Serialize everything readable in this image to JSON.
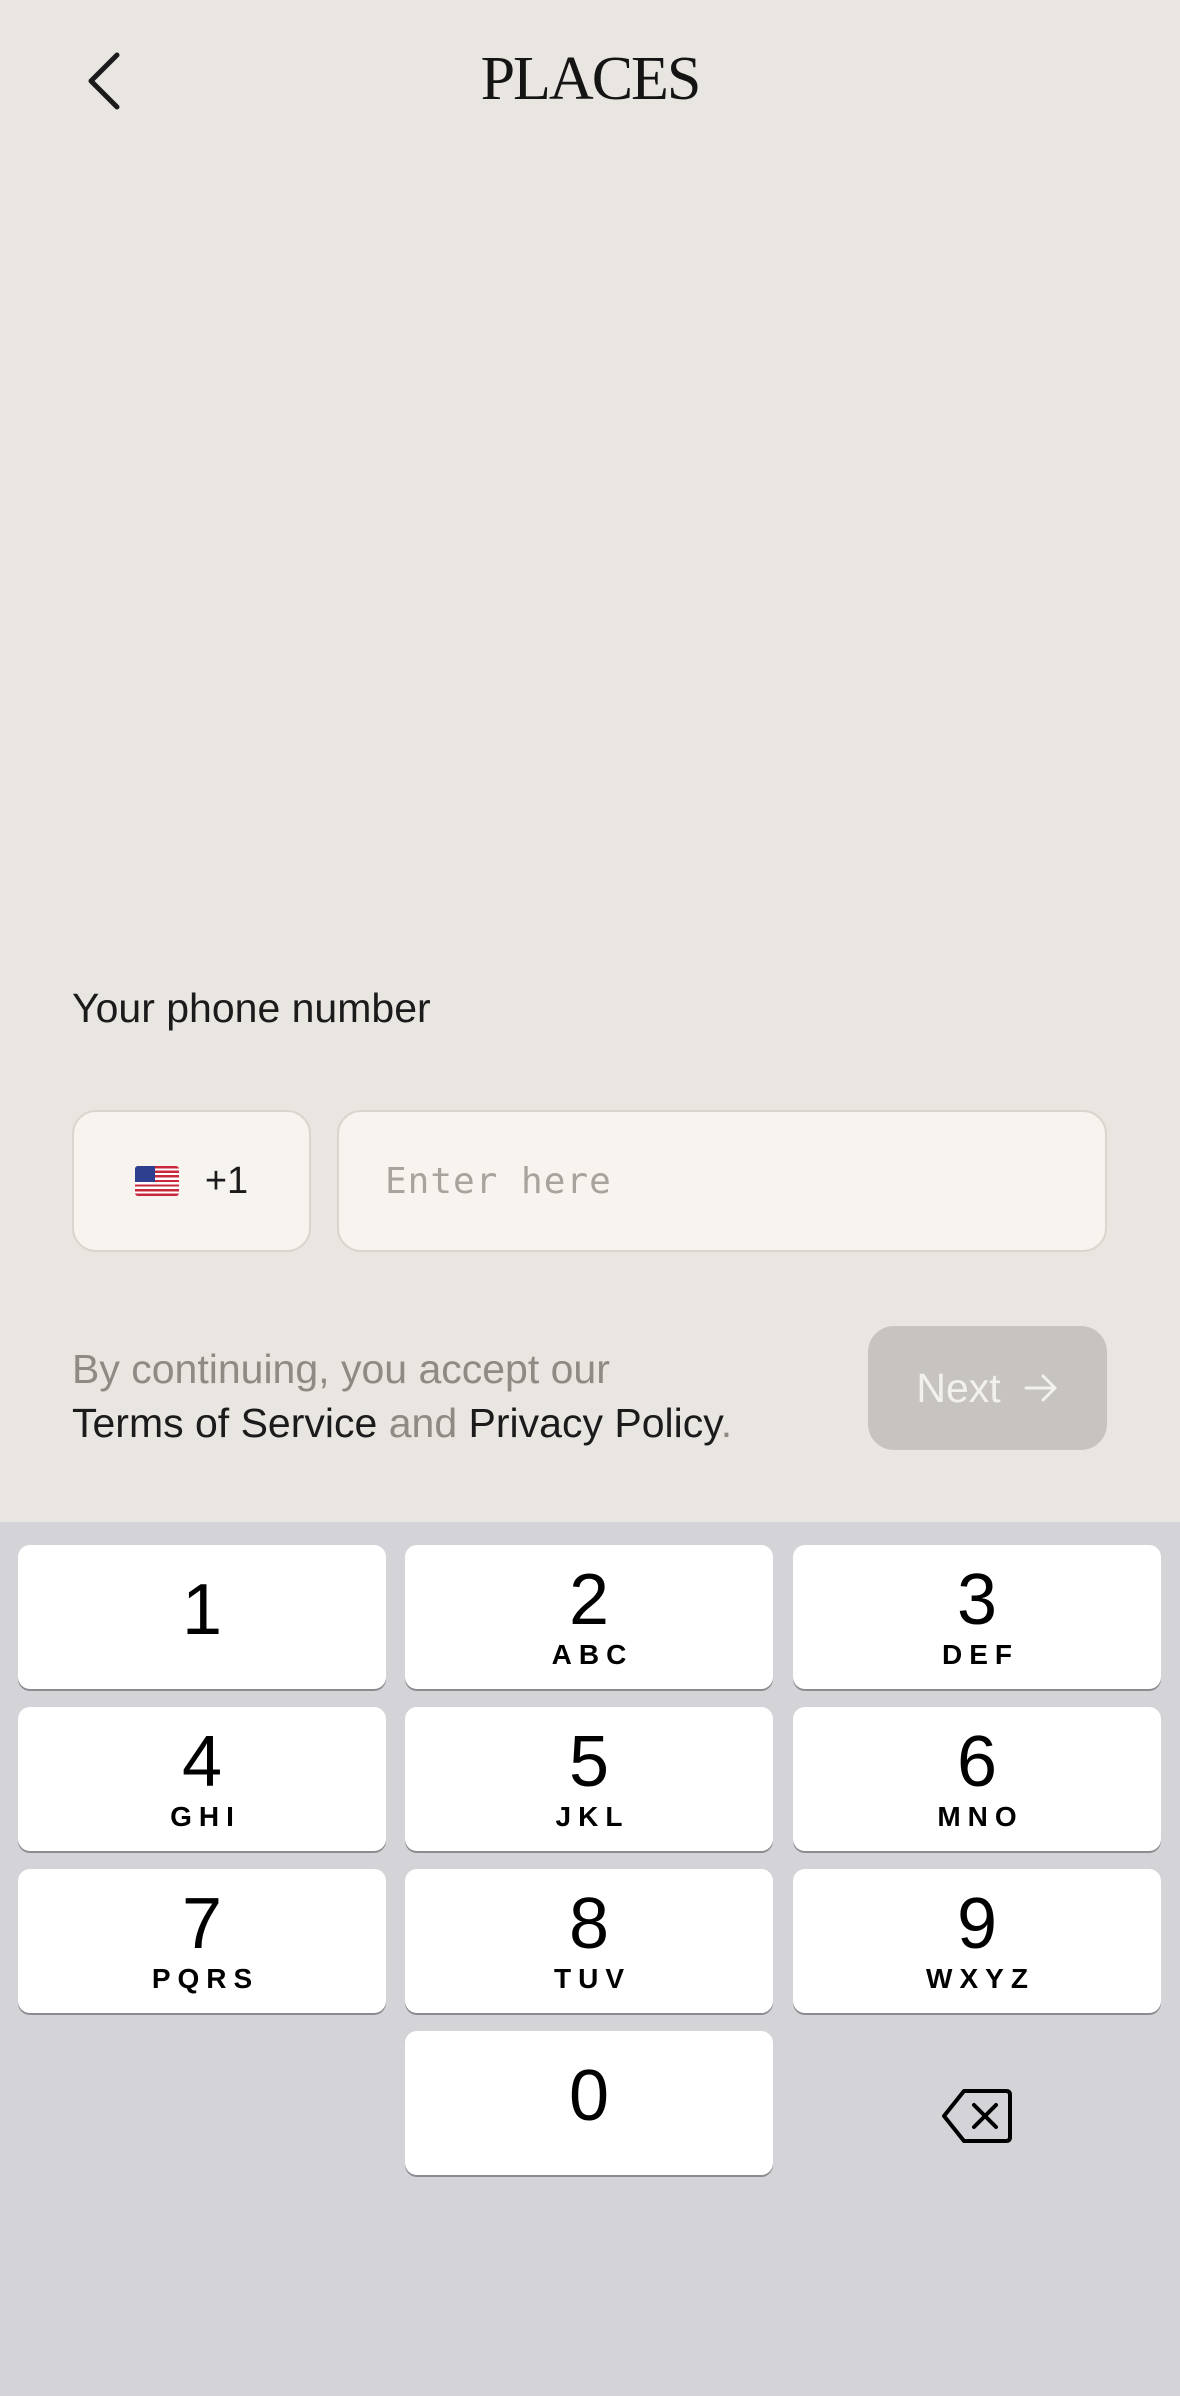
{
  "header": {
    "back_icon": "chevron-left-icon",
    "logo": "PLACES"
  },
  "phone": {
    "label": "Your phone number",
    "country_flag": "us-flag-icon",
    "country_code": "+1",
    "input_value": "",
    "input_placeholder": "Enter here"
  },
  "terms": {
    "prefix": "By continuing, you accept our",
    "terms_link": "Terms of Service",
    "and": "and",
    "privacy_link": "Privacy Policy",
    "suffix": "."
  },
  "next_button": {
    "label": "Next",
    "icon": "arrow-right-icon"
  },
  "keyboard": {
    "keys": [
      {
        "digit": "1",
        "letters": ""
      },
      {
        "digit": "2",
        "letters": "ABC"
      },
      {
        "digit": "3",
        "letters": "DEF"
      },
      {
        "digit": "4",
        "letters": "GHI"
      },
      {
        "digit": "5",
        "letters": "JKL"
      },
      {
        "digit": "6",
        "letters": "MNO"
      },
      {
        "digit": "7",
        "letters": "PQRS"
      },
      {
        "digit": "8",
        "letters": "TUV"
      },
      {
        "digit": "9",
        "letters": "WXYZ"
      },
      {
        "digit": "0",
        "letters": ""
      }
    ],
    "delete_icon": "backspace-icon"
  },
  "colors": {
    "background": "#e9e6e1",
    "input_background": "#f7f4ef",
    "button_disabled": "#c7c3be",
    "keyboard_background": "#d3d3d8"
  }
}
